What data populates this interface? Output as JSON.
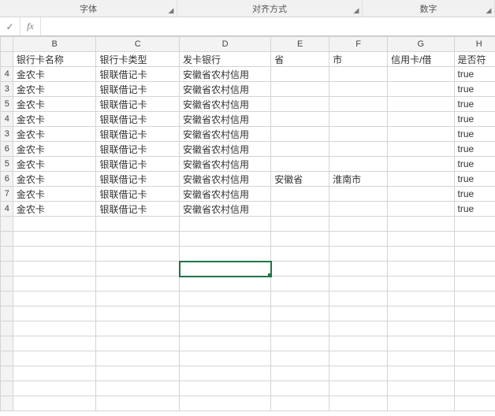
{
  "ribbon": {
    "font_group": "字体",
    "align_group": "对齐方式",
    "number_group": "数字"
  },
  "formula_bar": {
    "accept": "✓",
    "fx": "fx",
    "value": ""
  },
  "columns": [
    "B",
    "C",
    "D",
    "E",
    "F",
    "G",
    "H"
  ],
  "row_headers": [
    "",
    "4",
    "3",
    "5",
    "4",
    "3",
    "6",
    "5",
    "6",
    "7",
    "4"
  ],
  "header_row": {
    "B": "银行卡名称",
    "C": "银行卡类型",
    "D": "发卡银行",
    "E": "省",
    "F": "市",
    "G": "信用卡/借",
    "H": "是否符"
  },
  "rows": [
    {
      "B": "金农卡",
      "C": "银联借记卡",
      "D": "安徽省农村信用",
      "E": "",
      "F": "",
      "G": "",
      "H": "true"
    },
    {
      "B": "金农卡",
      "C": "银联借记卡",
      "D": "安徽省农村信用",
      "E": "",
      "F": "",
      "G": "",
      "H": "true"
    },
    {
      "B": "金农卡",
      "C": "银联借记卡",
      "D": "安徽省农村信用",
      "E": "",
      "F": "",
      "G": "",
      "H": "true"
    },
    {
      "B": "金农卡",
      "C": "银联借记卡",
      "D": "安徽省农村信用",
      "E": "",
      "F": "",
      "G": "",
      "H": "true"
    },
    {
      "B": "金农卡",
      "C": "银联借记卡",
      "D": "安徽省农村信用",
      "E": "",
      "F": "",
      "G": "",
      "H": "true"
    },
    {
      "B": "金农卡",
      "C": "银联借记卡",
      "D": "安徽省农村信用",
      "E": "",
      "F": "",
      "G": "",
      "H": "true"
    },
    {
      "B": "金农卡",
      "C": "银联借记卡",
      "D": "安徽省农村信用",
      "E": "",
      "F": "",
      "G": "",
      "H": "true"
    },
    {
      "B": "金农卡",
      "C": "银联借记卡",
      "D": "安徽省农村信用",
      "E": "安徽省",
      "F": "淮南市",
      "G": "",
      "H": "true"
    },
    {
      "B": "金农卡",
      "C": "银联借记卡",
      "D": "安徽省农村信用",
      "E": "",
      "F": "",
      "G": "",
      "H": "true"
    },
    {
      "B": "金农卡",
      "C": "银联借记卡",
      "D": "安徽省农村信用",
      "E": "",
      "F": "",
      "G": "",
      "H": "true"
    }
  ],
  "empty_rows": 13,
  "selected_cell": {
    "row_index": 15,
    "col": "D"
  },
  "chart_data": {
    "type": "table",
    "title": "",
    "columns": [
      "银行卡名称",
      "银行卡类型",
      "发卡银行",
      "省",
      "市",
      "信用卡/借",
      "是否符"
    ],
    "data": [
      [
        "金农卡",
        "银联借记卡",
        "安徽省农村信用",
        "",
        "",
        "",
        "true"
      ],
      [
        "金农卡",
        "银联借记卡",
        "安徽省农村信用",
        "",
        "",
        "",
        "true"
      ],
      [
        "金农卡",
        "银联借记卡",
        "安徽省农村信用",
        "",
        "",
        "",
        "true"
      ],
      [
        "金农卡",
        "银联借记卡",
        "安徽省农村信用",
        "",
        "",
        "",
        "true"
      ],
      [
        "金农卡",
        "银联借记卡",
        "安徽省农村信用",
        "",
        "",
        "",
        "true"
      ],
      [
        "金农卡",
        "银联借记卡",
        "安徽省农村信用",
        "",
        "",
        "",
        "true"
      ],
      [
        "金农卡",
        "银联借记卡",
        "安徽省农村信用",
        "",
        "",
        "",
        "true"
      ],
      [
        "金农卡",
        "银联借记卡",
        "安徽省农村信用",
        "安徽省",
        "淮南市",
        "",
        "true"
      ],
      [
        "金农卡",
        "银联借记卡",
        "安徽省农村信用",
        "",
        "",
        "",
        "true"
      ],
      [
        "金农卡",
        "银联借记卡",
        "安徽省农村信用",
        "",
        "",
        "",
        "true"
      ]
    ]
  }
}
